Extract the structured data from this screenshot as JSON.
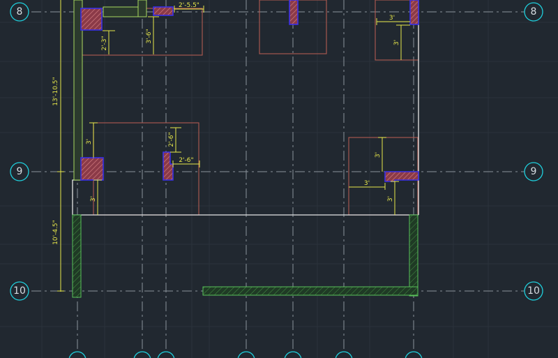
{
  "drawing": {
    "grid_rows": [
      "8",
      "9",
      "10"
    ],
    "dimensions": {
      "row_8_9": "13'-10.5\"",
      "row_9_10": "10'-4.5\"",
      "top_run": "2'-5.5\"",
      "top_left_drop_a": "2'-3\"",
      "top_left_drop_b": "3'-6\"",
      "top_right_run": "3'",
      "top_right_drop": "3'",
      "mid_left_drop": "3'",
      "mid_center_drop": "2'-6\"",
      "mid_center_run": "2'-6\"",
      "lower_left_drop": "3'",
      "right_drop_upper": "3'",
      "right_run": "3'",
      "right_drop_lower": "3'"
    },
    "colors": {
      "background": "#212830",
      "grid_bubble": "#1fd0dd",
      "axis_line": "#8c939b",
      "dimension": "#e8e84a",
      "room_outline": "#b25a52",
      "column_outline": "#3a30e8",
      "column_hatch": "#8b3a48",
      "exterior_wall": "#59c25a"
    }
  }
}
